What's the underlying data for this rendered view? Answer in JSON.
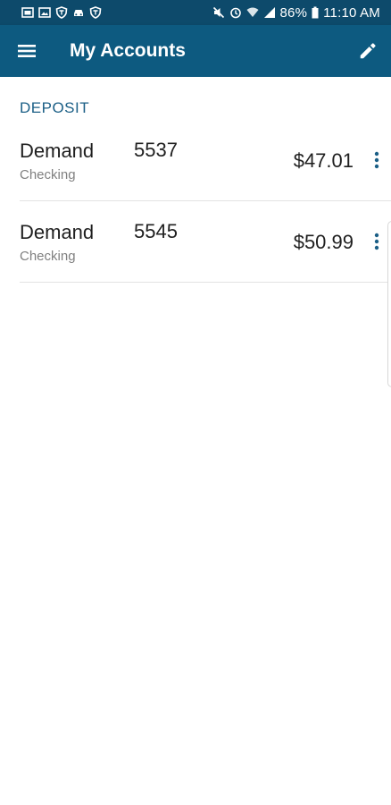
{
  "status_bar": {
    "battery": "86%",
    "time": "11:10 AM",
    "left_icons": [
      "gallery-icon",
      "image-icon",
      "shield-icon",
      "car-icon",
      "shield-icon"
    ],
    "right_icons": [
      "mute-icon",
      "alarm-icon",
      "wifi-icon",
      "signal-icon",
      "battery-icon"
    ]
  },
  "app_bar": {
    "title": "My Accounts",
    "menu_icon": "hamburger-menu-icon",
    "edit_icon": "pencil-icon"
  },
  "section": {
    "header": "DEPOSIT"
  },
  "accounts": [
    {
      "name": "Demand",
      "type": "Checking",
      "number": "5537",
      "balance": "$47.01"
    },
    {
      "name": "Demand",
      "type": "Checking",
      "number": "5545",
      "balance": "$50.99"
    }
  ],
  "colors": {
    "status_bar": "#0d4a6b",
    "app_bar": "#0d5a80",
    "section_header": "#1b5f86",
    "more_dots": "#1b5f86"
  }
}
